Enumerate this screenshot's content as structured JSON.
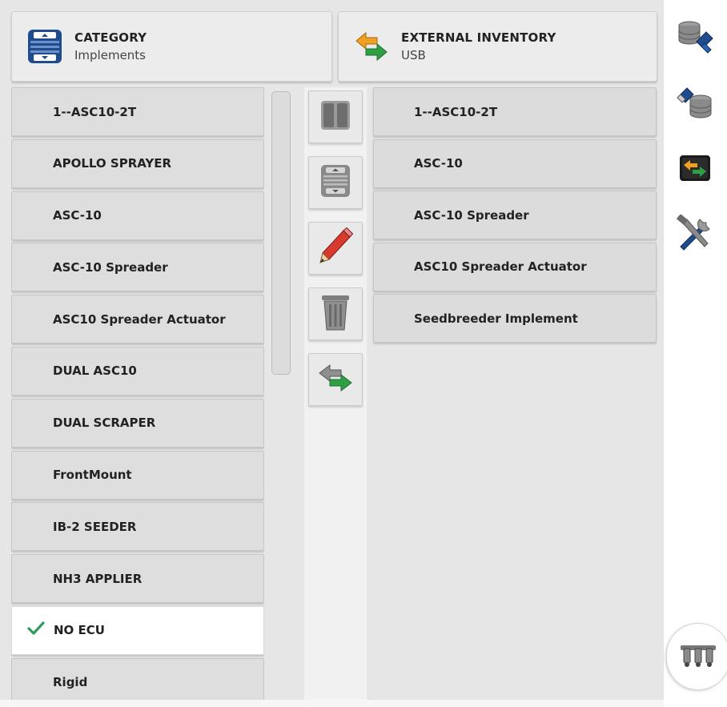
{
  "header": {
    "category": {
      "title": "CATEGORY",
      "value": "Implements",
      "icon": "category-selector-icon"
    },
    "external": {
      "title": "EXTERNAL INVENTORY",
      "value": "USB",
      "icon": "transfer-arrows-icon"
    }
  },
  "left_list": {
    "items": [
      {
        "label": "1--ASC10-2T"
      },
      {
        "label": "APOLLO SPRAYER"
      },
      {
        "label": "ASC-10"
      },
      {
        "label": "ASC-10 Spreader"
      },
      {
        "label": "ASC10 Spreader Actuator"
      },
      {
        "label": "DUAL ASC10"
      },
      {
        "label": "DUAL SCRAPER"
      },
      {
        "label": "FrontMount"
      },
      {
        "label": "IB-2 SEEDER"
      },
      {
        "label": "NH3 APPLIER"
      },
      {
        "label": "NO ECU",
        "selected": true
      },
      {
        "label": "Rigid"
      }
    ],
    "selected_check_icon": "checkmark-icon"
  },
  "toolbar": {
    "buttons": [
      {
        "name": "split-view-button",
        "icon": "split-view-icon"
      },
      {
        "name": "scroll-list-button",
        "icon": "list-scroll-icon"
      },
      {
        "name": "edit-button",
        "icon": "pencil-icon"
      },
      {
        "name": "delete-button",
        "icon": "trash-icon"
      },
      {
        "name": "transfer-button",
        "icon": "transfer-arrows-icon"
      }
    ]
  },
  "right_list": {
    "items": [
      {
        "label": "1--ASC10-2T"
      },
      {
        "label": "ASC-10"
      },
      {
        "label": "ASC-10 Spreader"
      },
      {
        "label": "ASC10 Spreader Actuator"
      },
      {
        "label": "Seedbreeder Implement"
      }
    ]
  },
  "sidebar": {
    "buttons": [
      {
        "name": "import-from-usb-button",
        "icon": "database-import-icon"
      },
      {
        "name": "export-to-usb-button",
        "icon": "usb-export-icon"
      },
      {
        "name": "data-transfer-button",
        "icon": "transfer-screen-icon"
      },
      {
        "name": "tools-button",
        "icon": "tools-icon"
      }
    ],
    "bottom_button": {
      "name": "implement-setup-button",
      "icon": "implement-controls-icon"
    }
  },
  "colors": {
    "background": "#e6e6e6",
    "row": "#dedede",
    "selected_row": "#ffffff",
    "check": "#2e9c5a",
    "icon_blue": "#1f4c8f",
    "arrow_orange": "#f2a020",
    "arrow_green": "#2ea043"
  }
}
